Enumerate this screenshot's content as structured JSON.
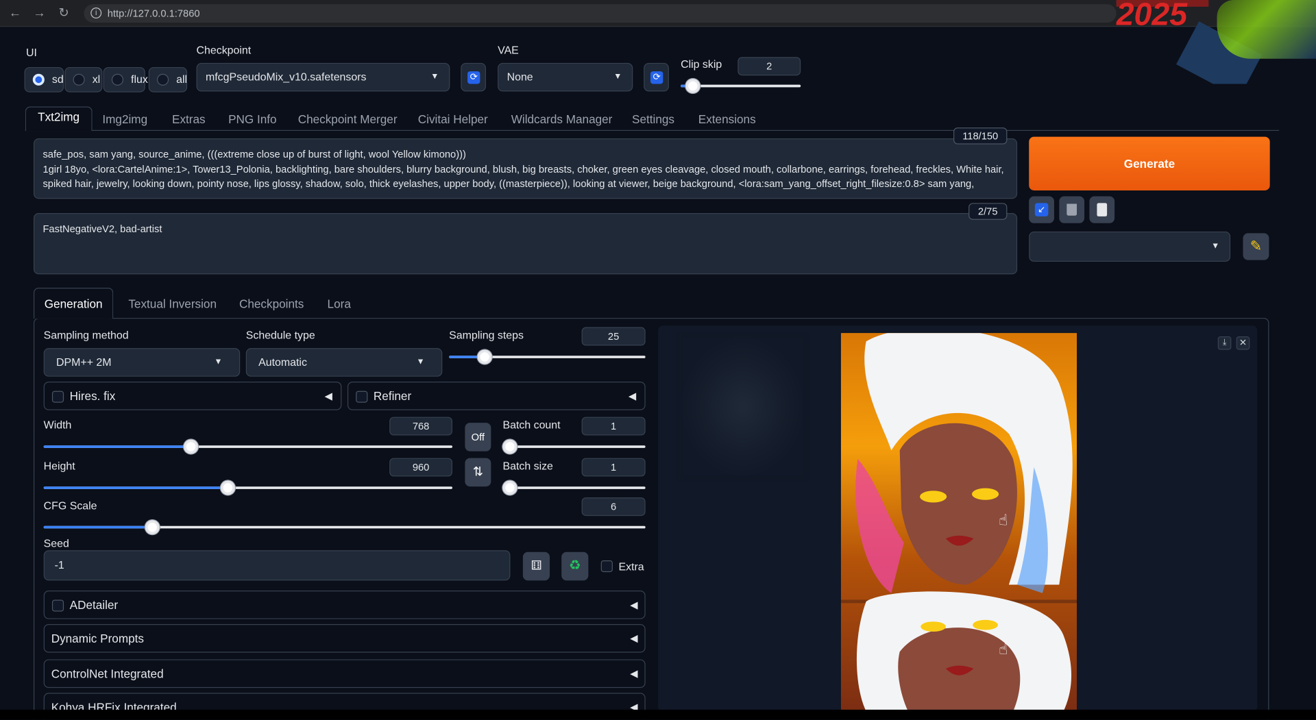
{
  "browser": {
    "url": "http://127.0.0.1:7860"
  },
  "top": {
    "ui_label": "UI",
    "ui_options": [
      "sd",
      "xl",
      "flux",
      "all"
    ],
    "ui_selected": "sd",
    "checkpoint_label": "Checkpoint",
    "checkpoint_value": "mfcgPseudoMix_v10.safetensors",
    "vae_label": "VAE",
    "vae_value": "None",
    "clip_skip_label": "Clip skip",
    "clip_skip_value": "2",
    "clip_skip_fraction": 0.1,
    "banner_text": "2025"
  },
  "tabs": [
    "Txt2img",
    "Img2img",
    "Extras",
    "PNG Info",
    "Checkpoint Merger",
    "Civitai Helper",
    "Wildcards Manager",
    "Settings",
    "Extensions"
  ],
  "prompt": {
    "line1": "safe_pos, sam yang, source_anime, (((extreme close up of burst of light, wool Yellow kimono)))",
    "line2": "1girl 18yo, <lora:CartelAnime:1>, Tower13_Polonia, backlighting, bare shoulders, blurry background, blush, big breasts, choker, green eyes cleavage, closed mouth, collarbone, earrings, forehead, freckles, White hair,",
    "line3": "spiked hair, jewelry, looking down, pointy nose,  lips glossy, shadow, solo, thick eyelashes, upper body, ((masterpiece)), looking at viewer, beige background,  <lora:sam_yang_offset_right_filesize:0.8> sam yang,",
    "counter": "118/150"
  },
  "negative": {
    "text": "FastNegativeV2, bad-artist",
    "counter": "2/75"
  },
  "actions": {
    "generate_label": "Generate"
  },
  "subtabs": [
    "Generation",
    "Textual Inversion",
    "Checkpoints",
    "Lora"
  ],
  "gen": {
    "sampling_method_label": "Sampling method",
    "sampling_method_value": "DPM++ 2M",
    "schedule_type_label": "Schedule type",
    "schedule_type_value": "Automatic",
    "sampling_steps_label": "Sampling steps",
    "sampling_steps_value": "25",
    "sampling_steps_fraction": 0.18,
    "hires_label": "Hires. fix",
    "refiner_label": "Refiner",
    "width_label": "Width",
    "width_value": "768",
    "width_fraction": 0.36,
    "height_label": "Height",
    "height_value": "960",
    "height_fraction": 0.45,
    "off_label": "Off",
    "batch_count_label": "Batch count",
    "batch_count_value": "1",
    "batch_size_label": "Batch size",
    "batch_size_value": "1",
    "cfg_label": "CFG Scale",
    "cfg_value": "6",
    "cfg_fraction": 0.18,
    "seed_label": "Seed",
    "seed_value": "-1",
    "extra_label": "Extra"
  },
  "accordions": [
    "ADetailer",
    "Dynamic Prompts",
    "ControlNet Integrated",
    "Kohya HRFix Integrated"
  ]
}
